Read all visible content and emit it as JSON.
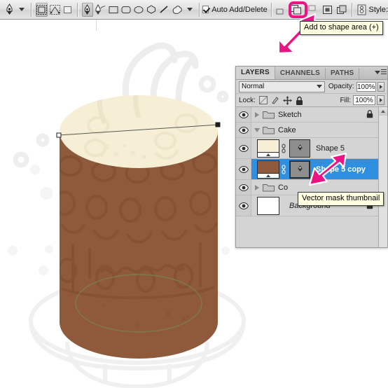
{
  "options_bar": {
    "tool_icon": "pen-tool-icon",
    "tool_preset_caret": "chevron-down-icon",
    "mode_buttons": [
      {
        "name": "shape-layers-mode",
        "icon": "shape-layers-icon",
        "active": true
      },
      {
        "name": "paths-mode",
        "icon": "paths-icon",
        "active": false
      },
      {
        "name": "fill-pixels-mode",
        "icon": "fill-pixels-icon",
        "active": false
      }
    ],
    "tool_buttons": [
      {
        "name": "pen-tool",
        "icon": "pen-icon",
        "active": true
      },
      {
        "name": "freeform-pen-tool",
        "icon": "freeform-pen-icon",
        "active": false
      },
      {
        "name": "rectangle-tool",
        "icon": "rectangle-icon",
        "active": false
      },
      {
        "name": "rounded-rectangle-tool",
        "icon": "rounded-rectangle-icon",
        "active": false
      },
      {
        "name": "ellipse-tool",
        "icon": "ellipse-icon",
        "active": false
      },
      {
        "name": "polygon-tool",
        "icon": "polygon-icon",
        "active": false
      },
      {
        "name": "line-tool",
        "icon": "line-icon",
        "active": false
      },
      {
        "name": "custom-shape-tool",
        "icon": "custom-shape-icon",
        "active": false
      }
    ],
    "geometry_caret": "chevron-down-icon",
    "auto_add_delete": {
      "label": "Auto Add/Delete",
      "checked": true
    },
    "path_ops": [
      {
        "name": "subtract-from-shape-area",
        "label": "Subtract from shape area (-)",
        "highlighted": false
      },
      {
        "name": "add-to-shape-area",
        "label": "Add to shape area (+)",
        "highlighted": true
      },
      {
        "name": "intersect-shape-areas",
        "label": "Intersect shape areas",
        "highlighted": false
      }
    ],
    "align_buttons": [
      {
        "name": "align-edges-button",
        "icon": "align-icon"
      },
      {
        "name": "distribute-button",
        "icon": "distribute-icon"
      }
    ],
    "style_label": "Style:",
    "style_icon": "layer-style-swatch-icon"
  },
  "tooltips": {
    "shape_area": "Add to shape area (+)",
    "vector_mask": "Vector mask thumbnail"
  },
  "annotations": {
    "arrow_color": "#ec1384",
    "arrow_top": {
      "name": "callout-arrow-toolbar",
      "points_to": "add-to-shape-area"
    },
    "arrow_layer": {
      "name": "callout-arrow-vector-mask",
      "points_to": "vector-mask-thumbnail"
    }
  },
  "layers_panel": {
    "tabs": [
      {
        "label": "LAYERS",
        "selected": true
      },
      {
        "label": "CHANNELS",
        "selected": false
      },
      {
        "label": "PATHS",
        "selected": false
      }
    ],
    "menu_icon": "panel-menu-icon",
    "blend_mode": "Normal",
    "opacity_label": "Opacity:",
    "opacity_value": "100%",
    "lock_label": "Lock:",
    "lock_icons": [
      "lock-transparent-pixels-icon",
      "lock-image-pixels-icon",
      "lock-position-icon",
      "lock-all-icon"
    ],
    "fill_label": "Fill:",
    "fill_value": "100%",
    "rows": [
      {
        "name": "layer-group-sketch",
        "type": "group",
        "label": "Sketch",
        "expanded": false,
        "locked": true,
        "visible": true,
        "selected": false
      },
      {
        "name": "layer-group-cake",
        "type": "group",
        "label": "Cake",
        "expanded": true,
        "locked": false,
        "visible": true,
        "selected": false
      },
      {
        "name": "layer-shape-5",
        "type": "shape",
        "label": "Shape 5",
        "thumb_color": "#f6efd6",
        "mask_icon": "vector-mask-pen-icon",
        "visible": true,
        "selected": false
      },
      {
        "name": "layer-shape-5-copy",
        "type": "shape",
        "label": "Shape 5 copy",
        "thumb_color": "#8f5a3c",
        "mask_icon": "vector-mask-pen-icon",
        "visible": true,
        "selected": true
      },
      {
        "name": "layer-group-co",
        "type": "group",
        "label": "Co",
        "expanded": false,
        "locked": false,
        "visible": true,
        "selected": false
      },
      {
        "name": "layer-background",
        "type": "background",
        "label": "Background",
        "thumb_color": "#ffffff",
        "locked": true,
        "visible": true,
        "selected": false
      }
    ],
    "selection_color": "#2f8fe0",
    "scrollbar": {
      "name": "layers-scrollbar",
      "arrow": "scroll-up-icon"
    }
  },
  "canvas": {
    "name": "document-canvas",
    "artwork": "chocolate-cake-illustration",
    "colors": {
      "cake_body": "#8f5a3c",
      "cake_body_shade": "#7d4c30",
      "frosting": "#f6efd6",
      "frosting_edge": "#eee6c8",
      "ghost_outline": "#ededed",
      "path_stroke": "#6f6f4a",
      "background": "#ffffff"
    }
  }
}
